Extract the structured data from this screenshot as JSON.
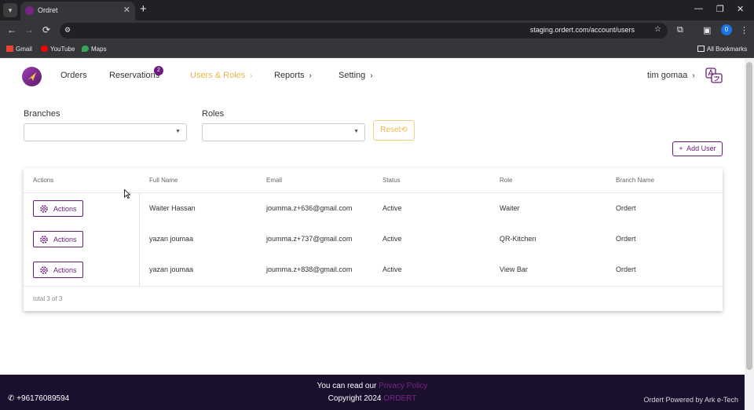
{
  "browser": {
    "tab_title": "Ordret",
    "url": "staging.ordert.com/account/users",
    "profile_initial": "0",
    "bookmarks": [
      "Gmail",
      "YouTube",
      "Maps"
    ],
    "all_bookmarks": "All Bookmarks"
  },
  "nav": {
    "orders": "Orders",
    "reservations": "Reservations",
    "reservations_badge": "2",
    "users_roles": "Users & Roles",
    "reports": "Reports",
    "setting": "Setting",
    "user_name": "tim gomaa"
  },
  "filters": {
    "branches_label": "Branches",
    "roles_label": "Roles",
    "reset_label": "Reset",
    "add_user_label": "Add User"
  },
  "table": {
    "columns": [
      "Actions",
      "Full Name",
      "Email",
      "Status",
      "Role",
      "Branch Name"
    ],
    "action_label": "Actions",
    "rows": [
      {
        "name": "Waiter Hassan",
        "email": "joumma.z+636@gmail.com",
        "status": "Active",
        "role": "Waiter",
        "branch": "Ordert"
      },
      {
        "name": "yazan joumaa",
        "email": "joumma.z+737@gmail.com",
        "status": "Active",
        "role": "QR-Kitchen",
        "branch": "Ordert"
      },
      {
        "name": "yazan joumaa",
        "email": "joumma.z+838@gmail.com",
        "status": "Active",
        "role": "View Bar",
        "branch": "Ordert"
      }
    ],
    "total": "total 3 of 3"
  },
  "footer": {
    "phone": "+96176089594",
    "privacy_prefix": "You can read our",
    "privacy_link": "Privacy Policy",
    "copyright_prefix": "Copyright 2024",
    "brand": "ORDERT",
    "powered": "Ordert Powered by Ark e-Tech"
  },
  "colors": {
    "brand_purple": "#6a1b7a",
    "active_nav": "#e8b84a",
    "footer_bg": "#1b0f2e"
  }
}
